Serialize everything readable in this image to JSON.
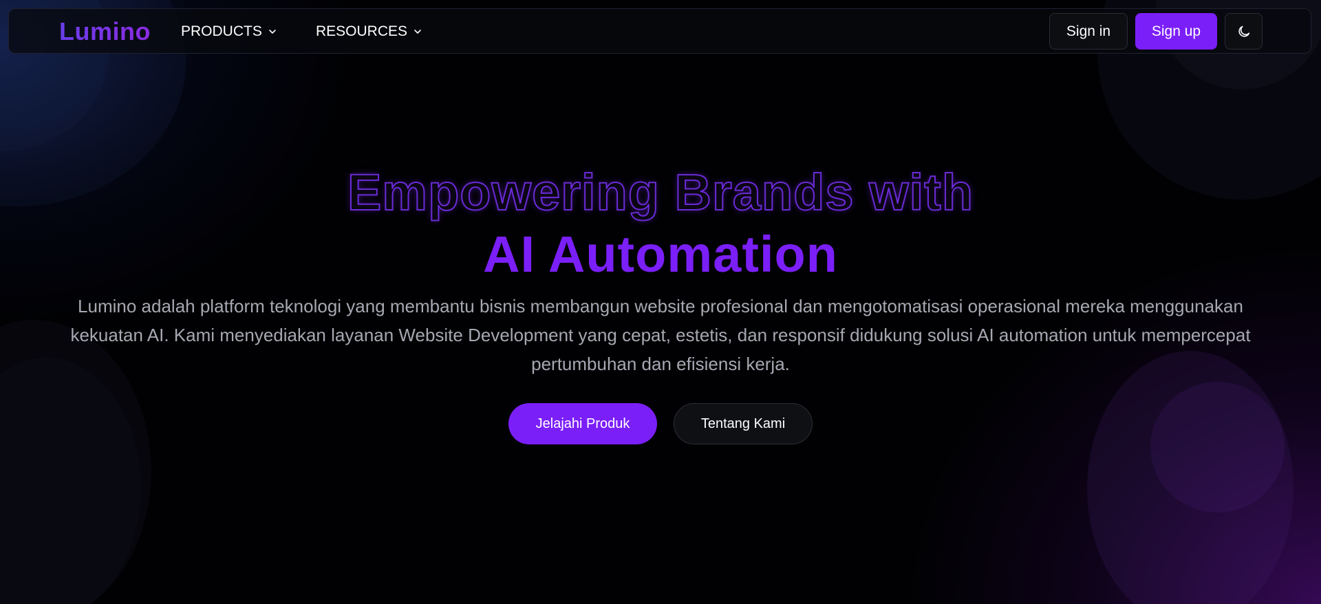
{
  "nav": {
    "brand": "Lumino",
    "items": [
      {
        "label": "PRODUCTS",
        "icon": "chevron-down-icon"
      },
      {
        "label": "RESOURCES",
        "icon": "chevron-down-icon"
      }
    ],
    "sign_in": "Sign in",
    "sign_up": "Sign up",
    "theme_toggle_icon": "moon-icon"
  },
  "hero": {
    "title_line1": "Empowering Brands with",
    "title_line2": "AI Automation",
    "description": "Lumino adalah platform teknologi yang membantu bisnis membangun website profesional dan mengotomatisasi operasional mereka menggunakan kekuatan AI. Kami menyediakan layanan Website Development yang cepat, estetis, dan responsif didukung solusi AI automation untuk mempercepat pertumbuhan dan efisiensi kerja.",
    "primary_cta": "Jelajahi Produk",
    "secondary_cta": "Tentang Kami"
  },
  "colors": {
    "accent": "#7b1ff8",
    "background": "#010103",
    "text_muted": "#a6a8b2"
  }
}
